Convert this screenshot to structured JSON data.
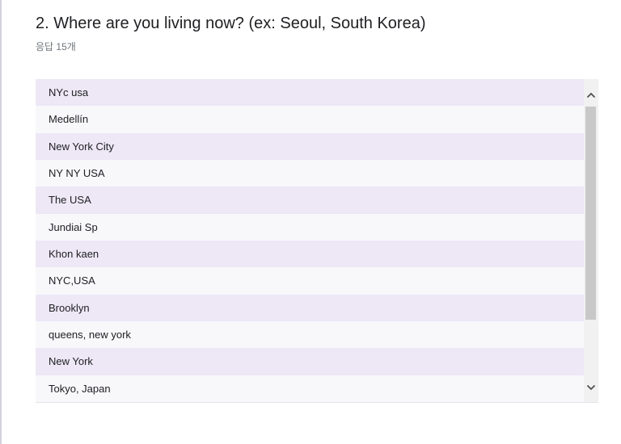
{
  "question": {
    "title": "2. Where are you living now? (ex: Seoul, South Korea)",
    "response_count": "응답 15개"
  },
  "responses": [
    "NYc usa",
    "Medellín",
    "New York City",
    "NY NY USA",
    "The USA",
    "Jundiai Sp",
    "Khon kaen",
    "NYC,USA",
    "Brooklyn",
    "queens, new york",
    "New York",
    "Tokyo, Japan"
  ],
  "scrollbar": {
    "up_icon": "chevron-up-icon",
    "down_icon": "chevron-down-icon"
  }
}
